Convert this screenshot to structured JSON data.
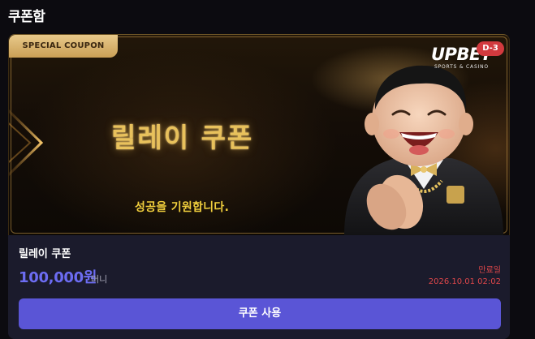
{
  "header": {
    "title": "쿠폰함"
  },
  "coupon": {
    "badge": "SPECIAL COUPON",
    "banner_title": "릴레이 쿠폰",
    "banner_subtitle": "성공을 기원합니다.",
    "brand": {
      "name": "UPBET",
      "tagline": "SPORTS & CASINO"
    },
    "dday": "D-3",
    "name": "릴레이 쿠폰",
    "amount": "100,000원",
    "amount_unit": "머니",
    "expiry_label": "만료일",
    "expiry_date": "2026.10.01 02:02",
    "use_button_label": "쿠폰 사용"
  },
  "colors": {
    "accent": "#5a55d6",
    "amount": "#6c6cf2",
    "expiry": "#e0474a",
    "gold": "#e8c15c",
    "badge": "#d23a3e"
  }
}
